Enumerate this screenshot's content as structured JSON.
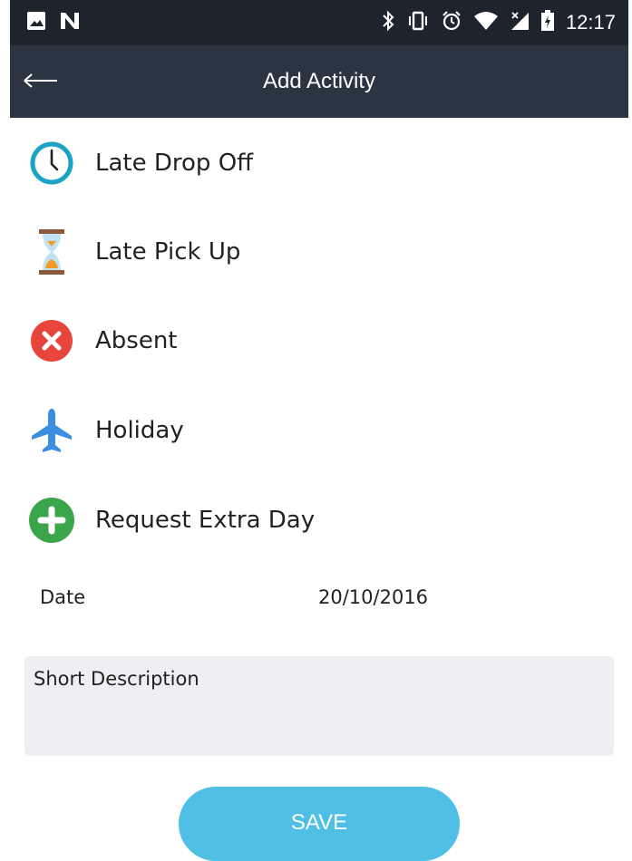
{
  "status_bar": {
    "time": "12:17",
    "icons": [
      "gallery-icon",
      "n-icon",
      "bluetooth-icon",
      "vibrate-icon",
      "alarm-icon",
      "wifi-icon",
      "signal-icon",
      "battery-charging-icon"
    ]
  },
  "app_bar": {
    "title": "Add Activity",
    "back_icon": "arrow-left-icon"
  },
  "activities": [
    {
      "label": "Late Drop Off",
      "icon": "clock-icon",
      "color": "#1aa3c4"
    },
    {
      "label": "Late Pick Up",
      "icon": "hourglass-icon",
      "color": "#f29b2a"
    },
    {
      "label": "Absent",
      "icon": "x-circle-icon",
      "color": "#e8453c"
    },
    {
      "label": "Holiday",
      "icon": "airplane-icon",
      "color": "#3a8fe0"
    },
    {
      "label": "Request Extra Day",
      "icon": "plus-circle-icon",
      "color": "#3aa54a"
    }
  ],
  "date": {
    "label": "Date",
    "value": "20/10/2016"
  },
  "description": {
    "placeholder": "Short Description"
  },
  "save_button": {
    "label": "SAVE",
    "color": "#4fbfe6"
  }
}
